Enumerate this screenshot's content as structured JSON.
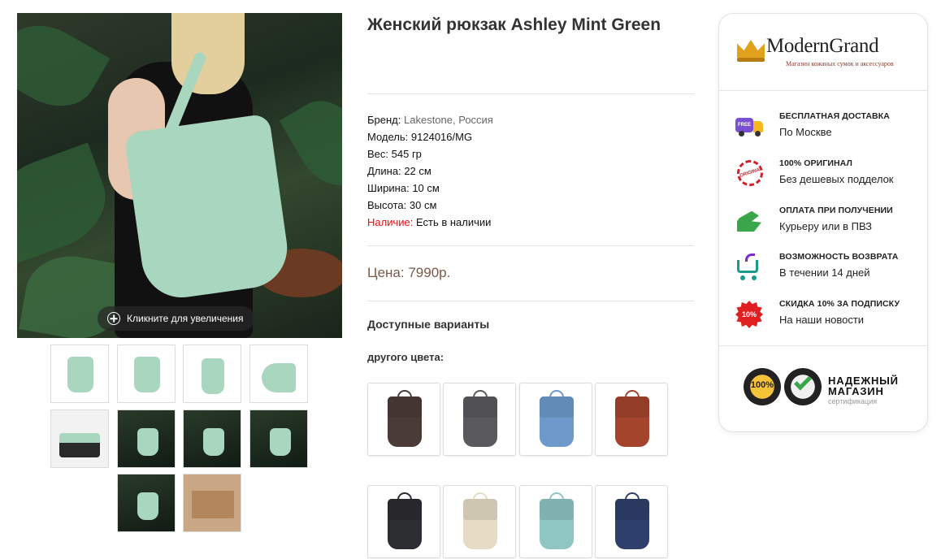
{
  "gallery": {
    "zoom_hint": "Кликните для увеличения",
    "thumbnails": [
      "mint-front",
      "mint-side",
      "mint-back",
      "mint-profile",
      "mint-open",
      "model-1",
      "model-2",
      "model-3",
      "model-4",
      "gift-box"
    ]
  },
  "product": {
    "title": "Женский рюкзак Ashley Mint Green",
    "specs": {
      "brand_label": "Бренд:",
      "brand_value": "Lakestone, Россия",
      "model_label": "Модель:",
      "model_value": "9124016/MG",
      "weight_label": "Вес:",
      "weight_value": "545 гр",
      "length_label": "Длина:",
      "length_value": "22 см",
      "width_label": "Ширина:",
      "width_value": "10 см",
      "height_label": "Высота:",
      "height_value": "30 см",
      "stock_label": "Наличие:",
      "stock_value": "Есть в наличии"
    },
    "price_label": "Цена:",
    "price_value": "7990р.",
    "variants_title": "Доступные варианты",
    "other_color_label": "другого цвета:",
    "color_variants": [
      {
        "color": "#4a3b36"
      },
      {
        "color": "#5a5a5e"
      },
      {
        "color": "#6e9acb"
      },
      {
        "color": "#a5442c"
      },
      {
        "color": "#2c2d31"
      },
      {
        "color": "#e6dcc6"
      },
      {
        "color": "#8fc6c4"
      },
      {
        "color": "#2e3f6b"
      }
    ]
  },
  "shop": {
    "logo_name": "ModernGrand",
    "logo_sub": "Магазин кожаных сумок и аксессуаров",
    "features": [
      {
        "icon": "delivery-truck-icon",
        "head": "БЕСПЛАТНАЯ ДОСТАВКА",
        "text": "По Москве",
        "badge": "FREE"
      },
      {
        "icon": "original-stamp-icon",
        "head": "100% ОРИГИНАЛ",
        "text": "Без дешевых подделок",
        "badge": "ORIGINAL"
      },
      {
        "icon": "cash-on-delivery-icon",
        "head": "ОПЛАТА ПРИ ПОЛУЧЕНИИ",
        "text": "Курьеру или в ПВЗ"
      },
      {
        "icon": "return-cart-icon",
        "head": "ВОЗМОЖНОСТЬ ВОЗВРАТА",
        "text": "В течении 14 дней"
      },
      {
        "icon": "discount-burst-icon",
        "head": "СКИДКА 10% ЗА ПОДПИСКУ",
        "text": "На наши новости",
        "badge": "10%"
      }
    ],
    "trust": {
      "seal_percent": "100%",
      "line1": "НАДЕЖНЫЙ",
      "line2": "МАГАЗИН",
      "sub": "сертификация"
    }
  }
}
